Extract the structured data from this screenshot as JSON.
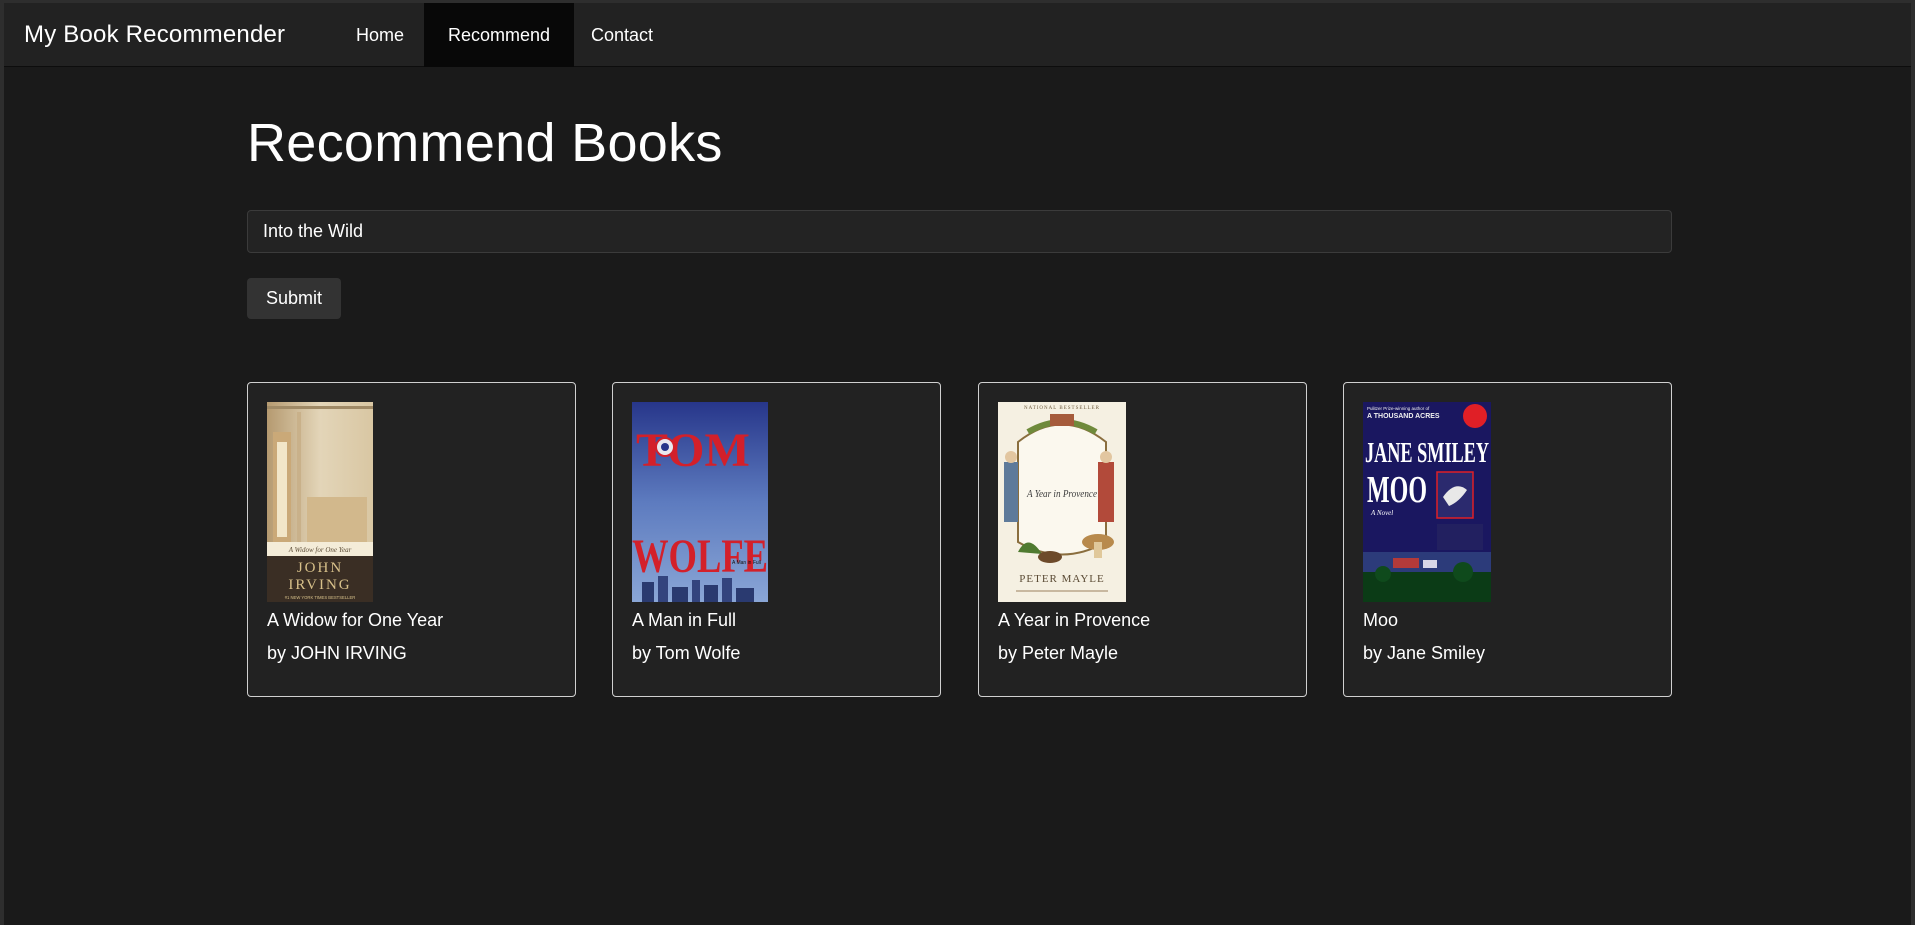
{
  "navbar": {
    "brand": "My Book Recommender",
    "items": [
      {
        "label": "Home",
        "active": false
      },
      {
        "label": "Recommend",
        "active": true
      },
      {
        "label": "Contact",
        "active": false
      }
    ]
  },
  "main": {
    "title": "Recommend Books",
    "search": {
      "value": "Into the Wild",
      "placeholder": ""
    },
    "submit_label": "Submit",
    "books": [
      {
        "title": "A Widow for One Year",
        "author_line": "by JOHN IRVING",
        "cover": {
          "subtitle": "A Widow for One Year",
          "author_top": "JOHN",
          "author_bottom": "IRVING",
          "banner": "#1 NEW YORK TIMES BESTSELLER"
        }
      },
      {
        "title": "A Man in Full",
        "author_line": "by Tom Wolfe",
        "cover": {
          "author_top": "TOM",
          "author_bottom": "WOLFE",
          "tag": "A Man in Full"
        }
      },
      {
        "title": "A Year in Provence",
        "author_line": "by Peter Mayle",
        "cover": {
          "banner": "NATIONAL BESTSELLER",
          "title": "A Year in Provence",
          "author": "PETER MAYLE"
        }
      },
      {
        "title": "Moo",
        "author_line": "by Jane Smiley",
        "cover": {
          "blurb": "Pulitzer Prize-winning author of",
          "blurb2": "A THOUSAND ACRES",
          "author": "JANE SMILEY",
          "title": "MOO",
          "subtitle": "A Novel"
        }
      }
    ]
  },
  "colors": {
    "background": "#1a1a1a",
    "navbar": "#222222",
    "nav_active": "#080808",
    "card": "#222222",
    "button": "#333333"
  }
}
